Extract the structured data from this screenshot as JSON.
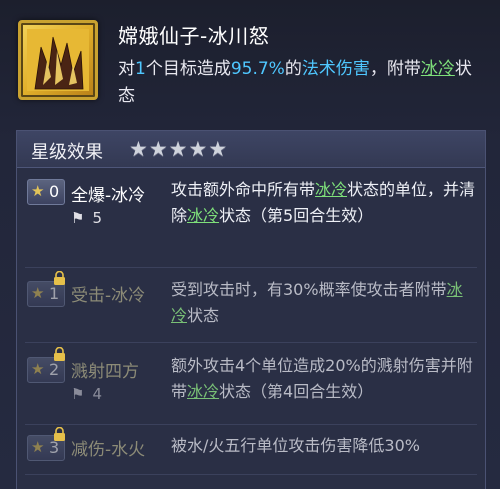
{
  "skill": {
    "icon": "ice-crystal-icon",
    "title": "嫦娥仙子-冰川怒",
    "desc_prefix": "对",
    "target_count": "1",
    "desc_mid1": "个目标造成",
    "percent": "95.7%",
    "desc_mid2": "的",
    "damage_type": "法术伤害",
    "desc_mid3": "，附带",
    "status": "冰冷",
    "desc_suffix": "状态"
  },
  "star_section": {
    "label": "星级效果",
    "rating": 5,
    "stars": [
      "★",
      "★",
      "★",
      "★",
      "★"
    ]
  },
  "effects": [
    {
      "star": "0",
      "name": "全爆-冰冷",
      "flag_count": "5",
      "locked": false,
      "desc_parts": [
        "攻击额外命中所有带",
        "冰冷",
        "状态的单位，并清除",
        "冰冷",
        "状态（第5回合生效）"
      ]
    },
    {
      "star": "1",
      "name": "受击-冰冷",
      "flag_count": "",
      "locked": true,
      "desc_parts": [
        "受到攻击时，有30%概率使攻击者附带",
        "冰冷",
        "状态"
      ]
    },
    {
      "star": "2",
      "name": "溅射四方",
      "flag_count": "4",
      "locked": true,
      "desc_parts": [
        "额外攻击4个单位造成20%的溅射伤害并附带",
        "冰冷",
        "状态（第4回合生效）"
      ]
    },
    {
      "star": "3",
      "name": "减伤-水火",
      "flag_count": "",
      "locked": true,
      "desc_parts": [
        "被水/火五行单位攻击伤害降低30%"
      ]
    }
  ],
  "colors": {
    "highlight_blue": "#4fc7ff",
    "highlight_green": "#7ee07a",
    "gold_frame": "#c9a230"
  }
}
